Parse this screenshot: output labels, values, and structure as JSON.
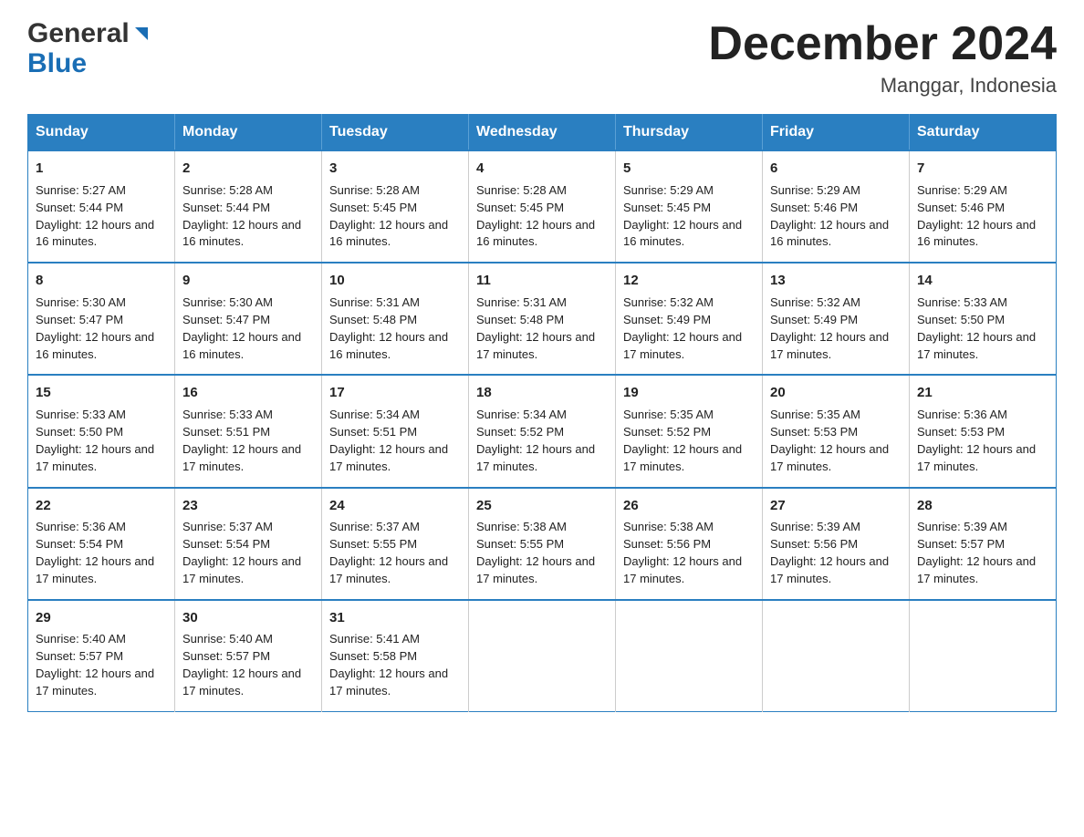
{
  "header": {
    "month_title": "December 2024",
    "location": "Manggar, Indonesia",
    "logo_general": "General",
    "logo_blue": "Blue"
  },
  "weekdays": [
    "Sunday",
    "Monday",
    "Tuesday",
    "Wednesday",
    "Thursday",
    "Friday",
    "Saturday"
  ],
  "weeks": [
    [
      {
        "day": "1",
        "sunrise": "5:27 AM",
        "sunset": "5:44 PM",
        "daylight": "12 hours and 16 minutes."
      },
      {
        "day": "2",
        "sunrise": "5:28 AM",
        "sunset": "5:44 PM",
        "daylight": "12 hours and 16 minutes."
      },
      {
        "day": "3",
        "sunrise": "5:28 AM",
        "sunset": "5:45 PM",
        "daylight": "12 hours and 16 minutes."
      },
      {
        "day": "4",
        "sunrise": "5:28 AM",
        "sunset": "5:45 PM",
        "daylight": "12 hours and 16 minutes."
      },
      {
        "day": "5",
        "sunrise": "5:29 AM",
        "sunset": "5:45 PM",
        "daylight": "12 hours and 16 minutes."
      },
      {
        "day": "6",
        "sunrise": "5:29 AM",
        "sunset": "5:46 PM",
        "daylight": "12 hours and 16 minutes."
      },
      {
        "day": "7",
        "sunrise": "5:29 AM",
        "sunset": "5:46 PM",
        "daylight": "12 hours and 16 minutes."
      }
    ],
    [
      {
        "day": "8",
        "sunrise": "5:30 AM",
        "sunset": "5:47 PM",
        "daylight": "12 hours and 16 minutes."
      },
      {
        "day": "9",
        "sunrise": "5:30 AM",
        "sunset": "5:47 PM",
        "daylight": "12 hours and 16 minutes."
      },
      {
        "day": "10",
        "sunrise": "5:31 AM",
        "sunset": "5:48 PM",
        "daylight": "12 hours and 16 minutes."
      },
      {
        "day": "11",
        "sunrise": "5:31 AM",
        "sunset": "5:48 PM",
        "daylight": "12 hours and 17 minutes."
      },
      {
        "day": "12",
        "sunrise": "5:32 AM",
        "sunset": "5:49 PM",
        "daylight": "12 hours and 17 minutes."
      },
      {
        "day": "13",
        "sunrise": "5:32 AM",
        "sunset": "5:49 PM",
        "daylight": "12 hours and 17 minutes."
      },
      {
        "day": "14",
        "sunrise": "5:33 AM",
        "sunset": "5:50 PM",
        "daylight": "12 hours and 17 minutes."
      }
    ],
    [
      {
        "day": "15",
        "sunrise": "5:33 AM",
        "sunset": "5:50 PM",
        "daylight": "12 hours and 17 minutes."
      },
      {
        "day": "16",
        "sunrise": "5:33 AM",
        "sunset": "5:51 PM",
        "daylight": "12 hours and 17 minutes."
      },
      {
        "day": "17",
        "sunrise": "5:34 AM",
        "sunset": "5:51 PM",
        "daylight": "12 hours and 17 minutes."
      },
      {
        "day": "18",
        "sunrise": "5:34 AM",
        "sunset": "5:52 PM",
        "daylight": "12 hours and 17 minutes."
      },
      {
        "day": "19",
        "sunrise": "5:35 AM",
        "sunset": "5:52 PM",
        "daylight": "12 hours and 17 minutes."
      },
      {
        "day": "20",
        "sunrise": "5:35 AM",
        "sunset": "5:53 PM",
        "daylight": "12 hours and 17 minutes."
      },
      {
        "day": "21",
        "sunrise": "5:36 AM",
        "sunset": "5:53 PM",
        "daylight": "12 hours and 17 minutes."
      }
    ],
    [
      {
        "day": "22",
        "sunrise": "5:36 AM",
        "sunset": "5:54 PM",
        "daylight": "12 hours and 17 minutes."
      },
      {
        "day": "23",
        "sunrise": "5:37 AM",
        "sunset": "5:54 PM",
        "daylight": "12 hours and 17 minutes."
      },
      {
        "day": "24",
        "sunrise": "5:37 AM",
        "sunset": "5:55 PM",
        "daylight": "12 hours and 17 minutes."
      },
      {
        "day": "25",
        "sunrise": "5:38 AM",
        "sunset": "5:55 PM",
        "daylight": "12 hours and 17 minutes."
      },
      {
        "day": "26",
        "sunrise": "5:38 AM",
        "sunset": "5:56 PM",
        "daylight": "12 hours and 17 minutes."
      },
      {
        "day": "27",
        "sunrise": "5:39 AM",
        "sunset": "5:56 PM",
        "daylight": "12 hours and 17 minutes."
      },
      {
        "day": "28",
        "sunrise": "5:39 AM",
        "sunset": "5:57 PM",
        "daylight": "12 hours and 17 minutes."
      }
    ],
    [
      {
        "day": "29",
        "sunrise": "5:40 AM",
        "sunset": "5:57 PM",
        "daylight": "12 hours and 17 minutes."
      },
      {
        "day": "30",
        "sunrise": "5:40 AM",
        "sunset": "5:57 PM",
        "daylight": "12 hours and 17 minutes."
      },
      {
        "day": "31",
        "sunrise": "5:41 AM",
        "sunset": "5:58 PM",
        "daylight": "12 hours and 17 minutes."
      },
      null,
      null,
      null,
      null
    ]
  ],
  "labels": {
    "sunrise_prefix": "Sunrise: ",
    "sunset_prefix": "Sunset: ",
    "daylight_prefix": "Daylight: "
  }
}
